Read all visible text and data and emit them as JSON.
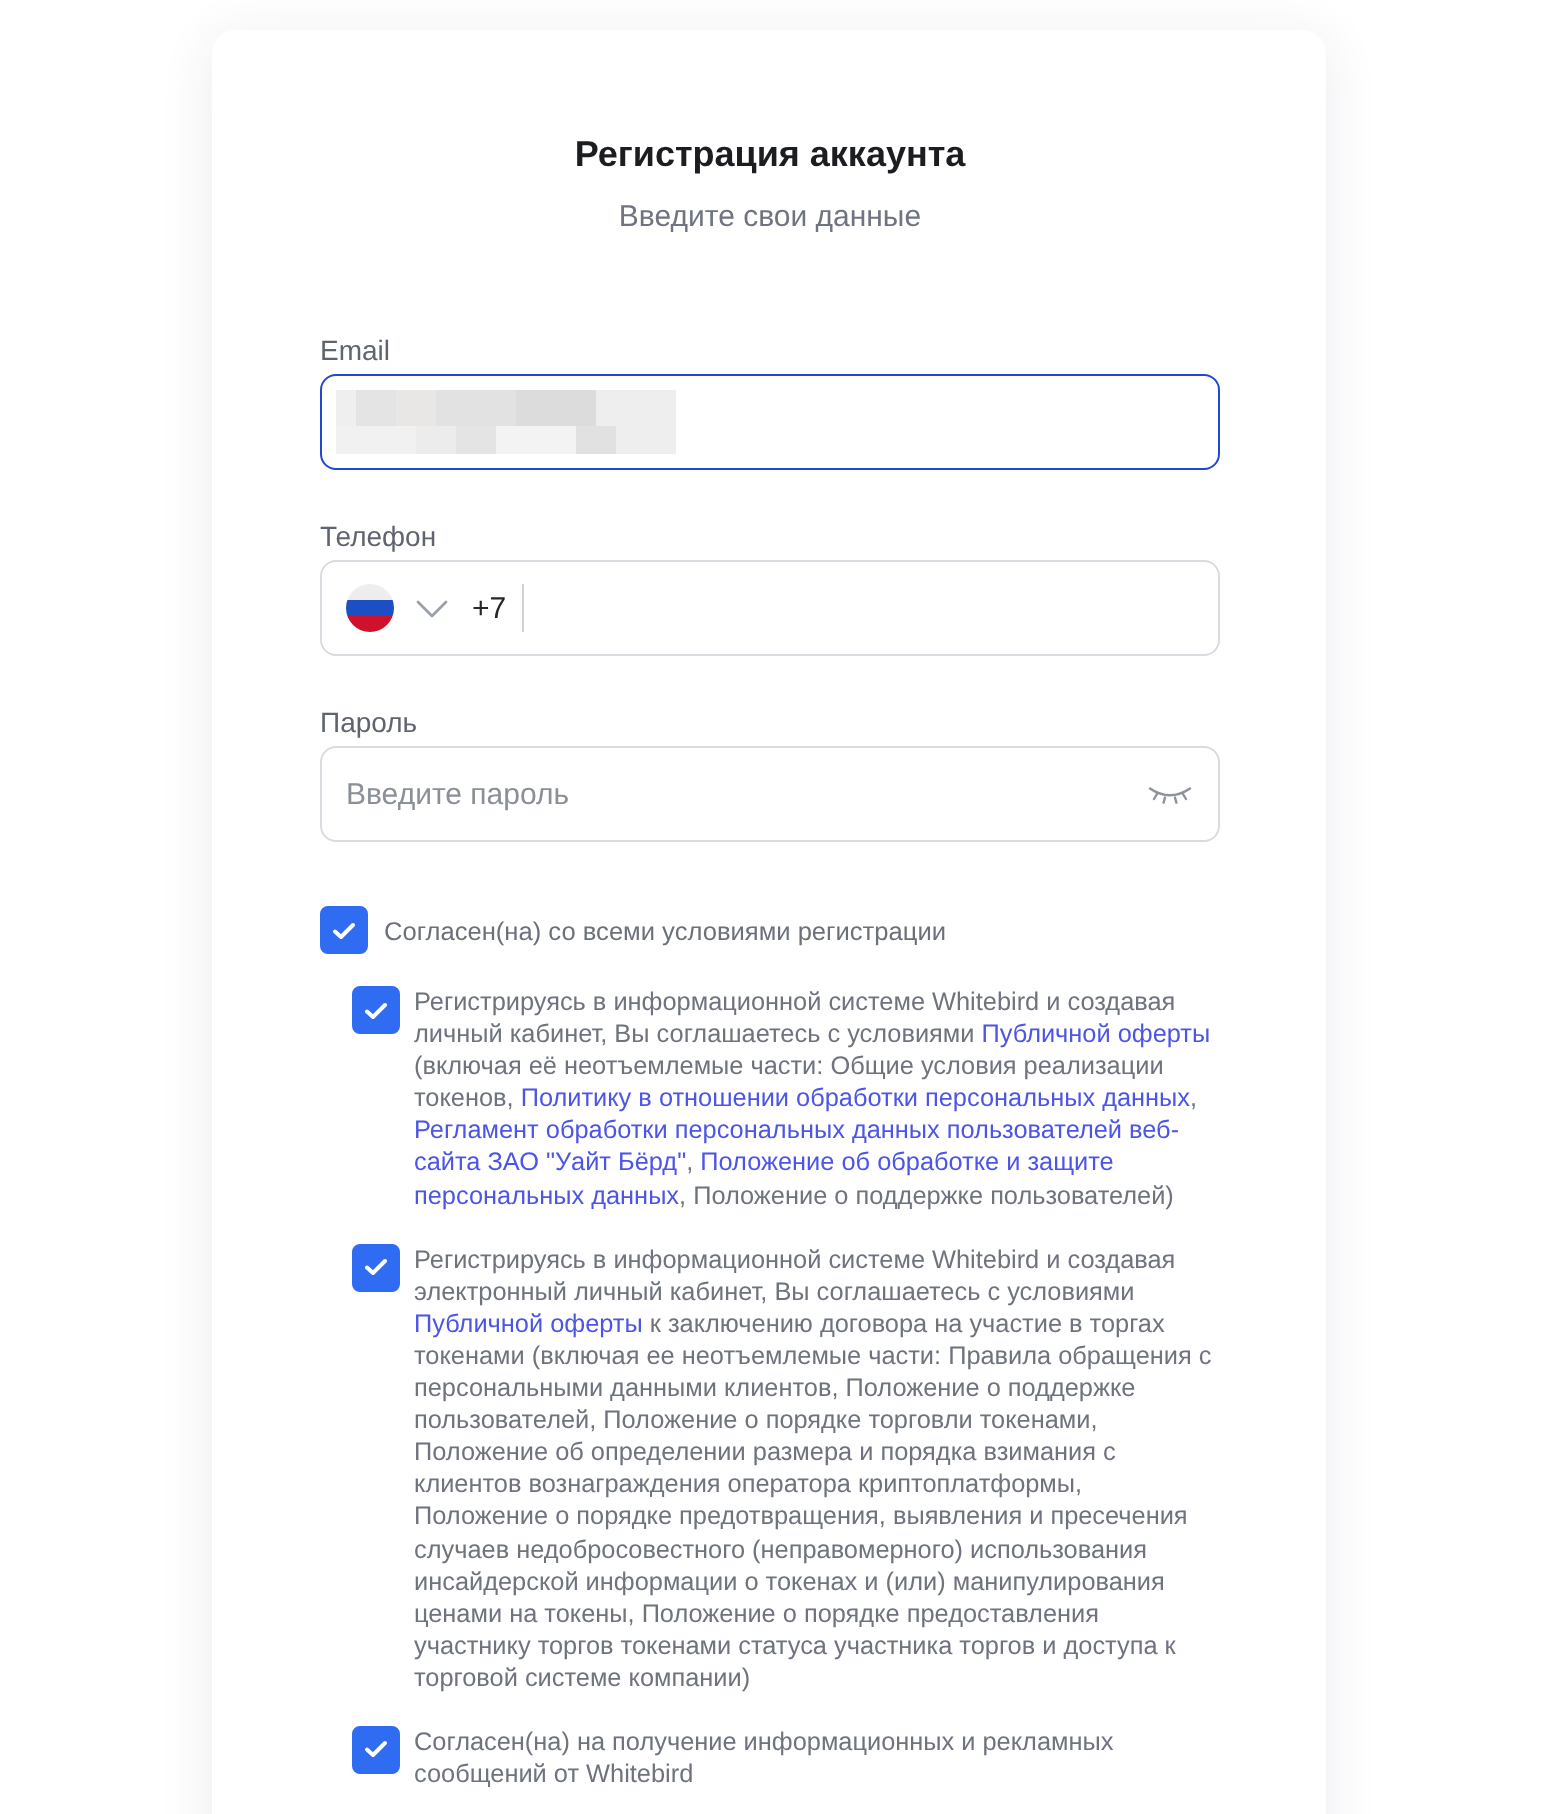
{
  "title": "Регистрация аккаунта",
  "subtitle": "Введите свои данные",
  "fields": [
    {
      "kind": "email",
      "label": "Email",
      "focused": true,
      "value_redacted": true
    },
    {
      "kind": "phone",
      "label": "Телефон",
      "focused": false,
      "country_code": "+7"
    },
    {
      "kind": "password",
      "label": "Пароль",
      "focused": false,
      "placeholder": "Введите пароль"
    }
  ],
  "consent": {
    "label": "Согласен(на) со всеми условиями регистрации",
    "checked": true,
    "children": [
      {
        "checked": true,
        "segments": [
          {
            "kind": "text",
            "text": "Регистрируясь в информационной системе Whitebird и создавая личный кабинет, Вы соглашаетесь с условиями "
          },
          {
            "kind": "link",
            "text": "Публичной оферты"
          },
          {
            "kind": "text",
            "text": " (включая её неотъемлемые части: Общие условия реализации токенов, "
          },
          {
            "kind": "link",
            "text": "Политику в отношении обработки персональных данных"
          },
          {
            "kind": "text",
            "text": ", "
          },
          {
            "kind": "link",
            "text": "Регламент обработки персональных данных пользователей веб-"
          },
          {
            "kind": "link",
            "text": "сайта ЗАО \"Уайт Бёрд\""
          },
          {
            "kind": "text",
            "text": ", "
          },
          {
            "kind": "link",
            "text": "Положение об обработке и защите "
          },
          {
            "kind": "link",
            "text": "персональных данных"
          },
          {
            "kind": "text",
            "text": ", Положение о поддержке пользователей)"
          }
        ]
      },
      {
        "checked": true,
        "segments": [
          {
            "kind": "text",
            "text": "Регистрируясь в информационной системе Whitebird и создавая электронный личный кабинет, Вы соглашаетесь с условиями "
          },
          {
            "kind": "link",
            "text": "Публичной оферты"
          },
          {
            "kind": "text",
            "text": " к заключению договора на участие в торгах токенами (включая ее неотъемлемые части: Правила обращения с персональными данными клиентов, Положение о поддержке пользователей, Положение о порядке торговли токенами, Положение об определении размера и порядка взимания с клиентов вознаграждения оператора криптоплатформы, Положение о порядке предотвращения, выявления и пресечения случаев недобросовестного (неправомерного) использования инсайдерской информации о токенах и (или) манипулирования ценами на токены, Положение о порядке предоставления участнику торгов токенами статуса участника торгов и доступа к торговой системе компании)"
          }
        ]
      },
      {
        "checked": true,
        "segments": [
          {
            "kind": "text",
            "text": "Согласен(на) на получение информационных и рекламных сообщений от Whitebird"
          }
        ]
      }
    ]
  }
}
